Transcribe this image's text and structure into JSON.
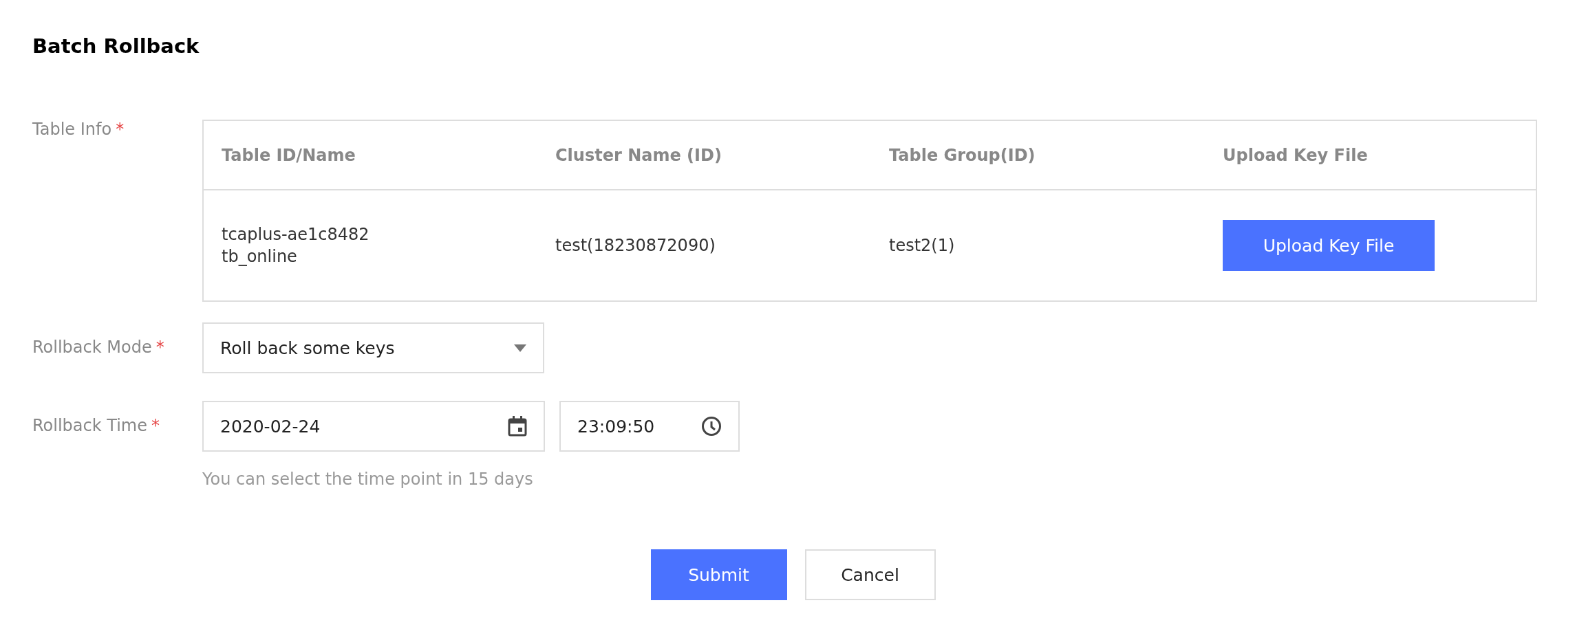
{
  "title": "Batch Rollback",
  "fields": [
    {
      "kind": "table",
      "label": "Table Info",
      "required_mark": "*",
      "columns": [
        "Table ID/Name",
        "Cluster Name (ID)",
        "Table Group(ID)",
        "Upload Key File"
      ],
      "rows": [
        {
          "table_id": "tcaplus-ae1c8482",
          "table_name": "tb_online",
          "cluster": "test(18230872090)",
          "group": "test2(1)",
          "action": "Upload Key File"
        }
      ]
    },
    {
      "kind": "select",
      "label": "Rollback Mode",
      "required_mark": "*",
      "value": "Roll back some keys"
    },
    {
      "kind": "datetime",
      "label": "Rollback Time",
      "required_mark": "*",
      "date": "2020-02-24",
      "time": "23:09:50",
      "hint": "You can select the time point in 15 days"
    }
  ],
  "buttons": [
    {
      "label": "Submit",
      "kind": "primary"
    },
    {
      "label": "Cancel",
      "kind": "secondary"
    }
  ]
}
